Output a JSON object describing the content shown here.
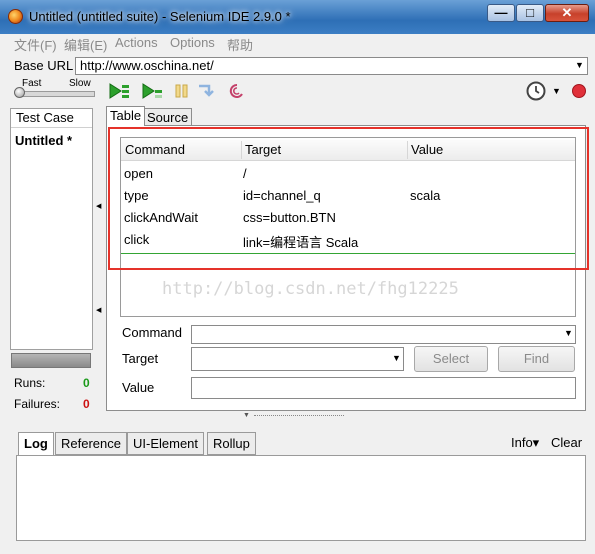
{
  "window": {
    "title": "Untitled (untitled suite) - Selenium IDE 2.9.0 *",
    "min_glyph": "—",
    "max_glyph": "□",
    "close_glyph": "✕"
  },
  "menu": [
    "文件(F)",
    "编辑(E)",
    "Actions",
    "Options",
    "帮助"
  ],
  "base_url": {
    "label": "Base URL",
    "value": "http://www.oschina.net/"
  },
  "toolbar": {
    "speed_fast": "Fast",
    "speed_slow": "Slow",
    "icons": [
      "play-all-icon",
      "play-current-icon",
      "pause-icon",
      "step-icon",
      "rollup-icon",
      "clock-icon",
      "record-icon"
    ]
  },
  "sidebar": {
    "header": "Test Case",
    "item": "Untitled *"
  },
  "stats": {
    "runs_label": "Runs:",
    "runs_value": "0",
    "failures_label": "Failures:",
    "failures_value": "0"
  },
  "editor": {
    "tabs": [
      "Table",
      "Source"
    ],
    "columns": [
      "Command",
      "Target",
      "Value"
    ],
    "rows": [
      {
        "command": "open",
        "target": "/",
        "value": ""
      },
      {
        "command": "type",
        "target": "id=channel_q",
        "value": "scala"
      },
      {
        "command": "clickAndWait",
        "target": "css=button.BTN",
        "value": ""
      },
      {
        "command": "click",
        "target": "link=编程语言 Scala",
        "value": ""
      }
    ],
    "watermark": "http://blog.csdn.net/fhg12225"
  },
  "fields": {
    "command_label": "Command",
    "target_label": "Target",
    "value_label": "Value",
    "select_button": "Select",
    "find_button": "Find"
  },
  "bottom_tabs": [
    "Log",
    "Reference",
    "UI-Element",
    "Rollup"
  ],
  "log_actions": {
    "info": "Info▾",
    "clear": "Clear"
  }
}
